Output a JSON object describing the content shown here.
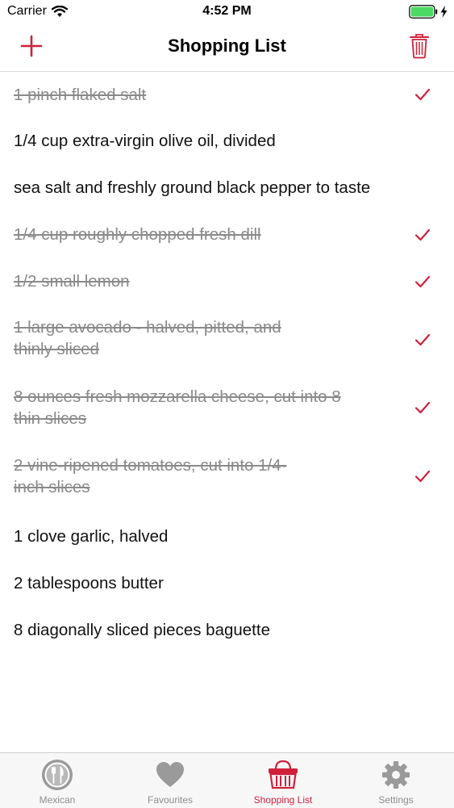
{
  "status": {
    "carrier": "Carrier",
    "time": "4:52 PM"
  },
  "nav": {
    "title": "Shopping List",
    "add_icon": "plus-icon",
    "trash_icon": "trash-icon"
  },
  "colors": {
    "accent": "#d0213b",
    "done_text": "#8a8a8a",
    "battery": "#4cd964"
  },
  "items": [
    {
      "lines": [
        "1 pinch flaked salt"
      ],
      "done": true
    },
    {
      "lines": [
        "1/4 cup extra-virgin olive oil, divided"
      ],
      "done": false
    },
    {
      "lines": [
        "sea salt and freshly ground black pepper to taste"
      ],
      "done": false
    },
    {
      "lines": [
        "1/4 cup roughly chopped fresh dill"
      ],
      "done": true
    },
    {
      "lines": [
        "1/2 small lemon"
      ],
      "done": true
    },
    {
      "lines": [
        "1 large avocado - halved, pitted, and",
        "thinly sliced"
      ],
      "done": true
    },
    {
      "lines": [
        "8 ounces fresh mozzarella cheese, cut into 8",
        "thin slices"
      ],
      "done": true
    },
    {
      "lines": [
        "2 vine-ripened tomatoes, cut into 1/4-",
        "inch slices"
      ],
      "done": true
    },
    {
      "lines": [
        "1 clove garlic, halved"
      ],
      "done": false
    },
    {
      "lines": [
        "2 tablespoons butter"
      ],
      "done": false
    },
    {
      "lines": [
        "8 diagonally sliced pieces baguette"
      ],
      "done": false
    }
  ],
  "tabs": [
    {
      "label": "Mexican",
      "icon": "plate-cutlery-icon",
      "active": false
    },
    {
      "label": "Favourites",
      "icon": "heart-icon",
      "active": false
    },
    {
      "label": "Shopping List",
      "icon": "basket-icon",
      "active": true
    },
    {
      "label": "Settings",
      "icon": "gear-icon",
      "active": false
    }
  ]
}
